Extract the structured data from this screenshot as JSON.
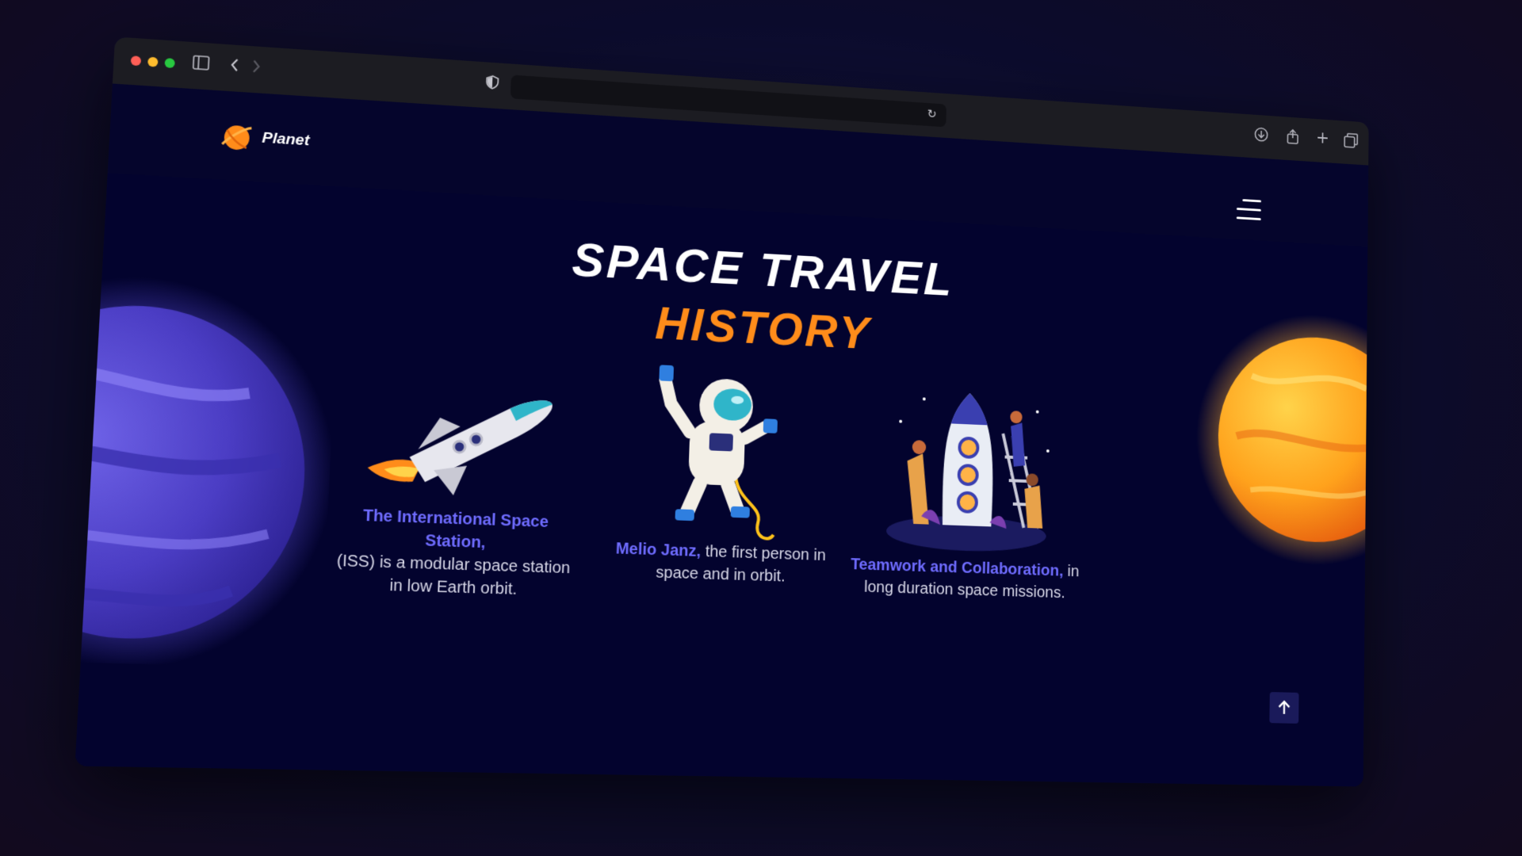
{
  "browser": {
    "sidebar_icon": "sidebar-icon",
    "back_icon": "chevron-left-icon",
    "forward_icon": "chevron-right-icon",
    "shield_icon": "shield-icon",
    "reload_icon": "reload-icon",
    "download_icon": "download-icon",
    "share_icon": "share-icon",
    "new_tab_icon": "plus-icon",
    "tabs_icon": "tabs-icon"
  },
  "header": {
    "logo_text": "Planet",
    "menu_icon": "hamburger-menu-icon"
  },
  "hero": {
    "title_line1": "SPACE TRAVEL",
    "title_line2": "HISTORY"
  },
  "cards": [
    {
      "highlight": "The International Space Station,",
      "text": "(ISS) is a modular space station in low Earth orbit."
    },
    {
      "highlight": "Melio Janz,",
      "text": "the first person in space and in orbit."
    },
    {
      "highlight": "Teamwork and Collaboration,",
      "text": "in long duration space missions."
    }
  ],
  "scroll_top_icon": "arrow-up-icon",
  "colors": {
    "accent_orange": "#ff8c1a",
    "highlight_blue": "#6f6cff",
    "page_bg": "#03032e"
  }
}
